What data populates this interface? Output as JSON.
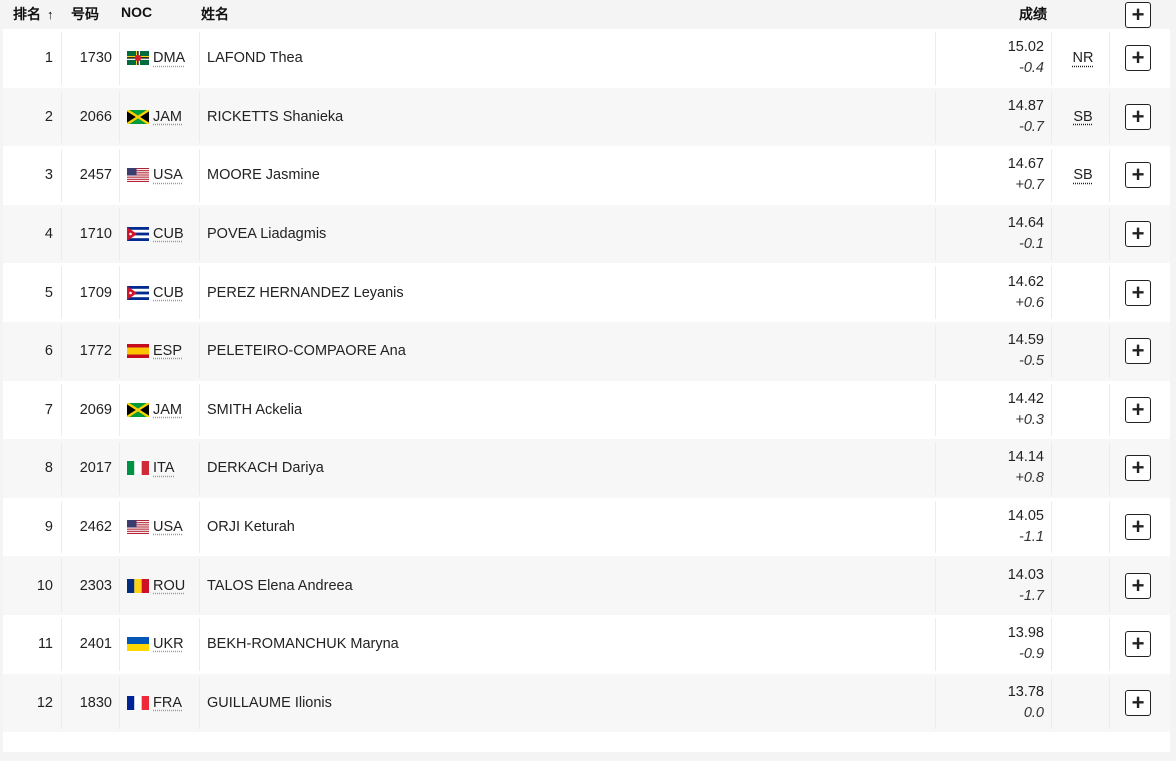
{
  "header": {
    "rank": "排名",
    "rank_sort_arrow": "↑",
    "bib": "号码",
    "noc": "NOC",
    "name": "姓名",
    "mark": "成绩",
    "expand_label": "+"
  },
  "rows": [
    {
      "rank": "1",
      "bib": "1730",
      "noc": "DMA",
      "flag": "dma-flag-icon",
      "name": "LAFOND Thea",
      "mark": "15.02",
      "wind": "-0.4",
      "record": "NR"
    },
    {
      "rank": "2",
      "bib": "2066",
      "noc": "JAM",
      "flag": "jam-flag-icon",
      "name": "RICKETTS Shanieka",
      "mark": "14.87",
      "wind": "-0.7",
      "record": "SB"
    },
    {
      "rank": "3",
      "bib": "2457",
      "noc": "USA",
      "flag": "usa-flag-icon",
      "name": "MOORE Jasmine",
      "mark": "14.67",
      "wind": "+0.7",
      "record": "SB"
    },
    {
      "rank": "4",
      "bib": "1710",
      "noc": "CUB",
      "flag": "cub-flag-icon",
      "name": "POVEA Liadagmis",
      "mark": "14.64",
      "wind": "-0.1",
      "record": ""
    },
    {
      "rank": "5",
      "bib": "1709",
      "noc": "CUB",
      "flag": "cub-flag-icon",
      "name": "PEREZ HERNANDEZ Leyanis",
      "mark": "14.62",
      "wind": "+0.6",
      "record": ""
    },
    {
      "rank": "6",
      "bib": "1772",
      "noc": "ESP",
      "flag": "esp-flag-icon",
      "name": "PELETEIRO-COMPAORE Ana",
      "mark": "14.59",
      "wind": "-0.5",
      "record": ""
    },
    {
      "rank": "7",
      "bib": "2069",
      "noc": "JAM",
      "flag": "jam-flag-icon",
      "name": "SMITH Ackelia",
      "mark": "14.42",
      "wind": "+0.3",
      "record": ""
    },
    {
      "rank": "8",
      "bib": "2017",
      "noc": "ITA",
      "flag": "ita-flag-icon",
      "name": "DERKACH Dariya",
      "mark": "14.14",
      "wind": "+0.8",
      "record": ""
    },
    {
      "rank": "9",
      "bib": "2462",
      "noc": "USA",
      "flag": "usa-flag-icon",
      "name": "ORJI Keturah",
      "mark": "14.05",
      "wind": "-1.1",
      "record": ""
    },
    {
      "rank": "10",
      "bib": "2303",
      "noc": "ROU",
      "flag": "rou-flag-icon",
      "name": "TALOS Elena Andreea",
      "mark": "14.03",
      "wind": "-1.7",
      "record": ""
    },
    {
      "rank": "11",
      "bib": "2401",
      "noc": "UKR",
      "flag": "ukr-flag-icon",
      "name": "BEKH-ROMANCHUK Maryna",
      "mark": "13.98",
      "wind": "-0.9",
      "record": ""
    },
    {
      "rank": "12",
      "bib": "1830",
      "noc": "FRA",
      "flag": "fra-flag-icon",
      "name": "GUILLAUME Ilionis",
      "mark": "13.78",
      "wind": "0.0",
      "record": ""
    }
  ]
}
